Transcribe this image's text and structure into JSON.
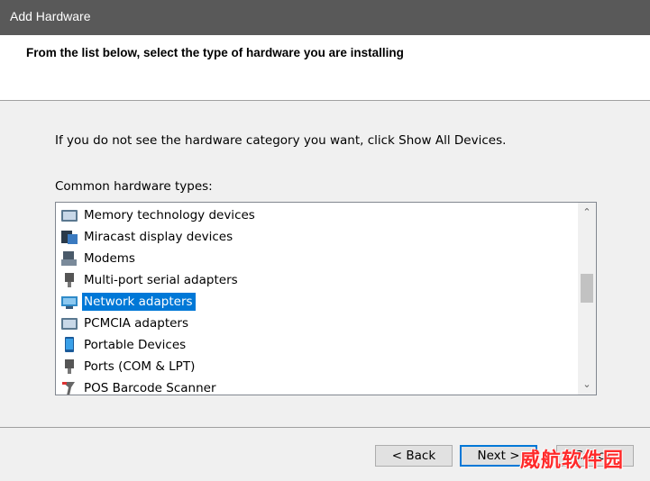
{
  "window": {
    "title": "Add Hardware"
  },
  "header": {
    "heading": "From the list below, select the type of hardware you are installing"
  },
  "instructions": "If you do not see the hardware category you want, click Show All Devices.",
  "list_label": "Common hardware types:",
  "hardware_types": [
    {
      "label": "Memory technology devices",
      "icon": "memory-device-icon"
    },
    {
      "label": "Miracast display devices",
      "icon": "miracast-icon"
    },
    {
      "label": "Modems",
      "icon": "modem-icon"
    },
    {
      "label": "Multi-port serial adapters",
      "icon": "serial-adapter-icon"
    },
    {
      "label": "Network adapters",
      "icon": "network-adapter-icon",
      "selected": true
    },
    {
      "label": "PCMCIA adapters",
      "icon": "pcmcia-icon"
    },
    {
      "label": "Portable Devices",
      "icon": "portable-device-icon"
    },
    {
      "label": "Ports (COM & LPT)",
      "icon": "port-icon"
    },
    {
      "label": "POS Barcode Scanner",
      "icon": "barcode-scanner-icon"
    }
  ],
  "buttons": {
    "back": "< Back",
    "next": "Next >",
    "cancel": "Cancel"
  },
  "watermark": "威航软件园",
  "colors": {
    "selection": "#0078d7",
    "titlebar": "#595959"
  }
}
